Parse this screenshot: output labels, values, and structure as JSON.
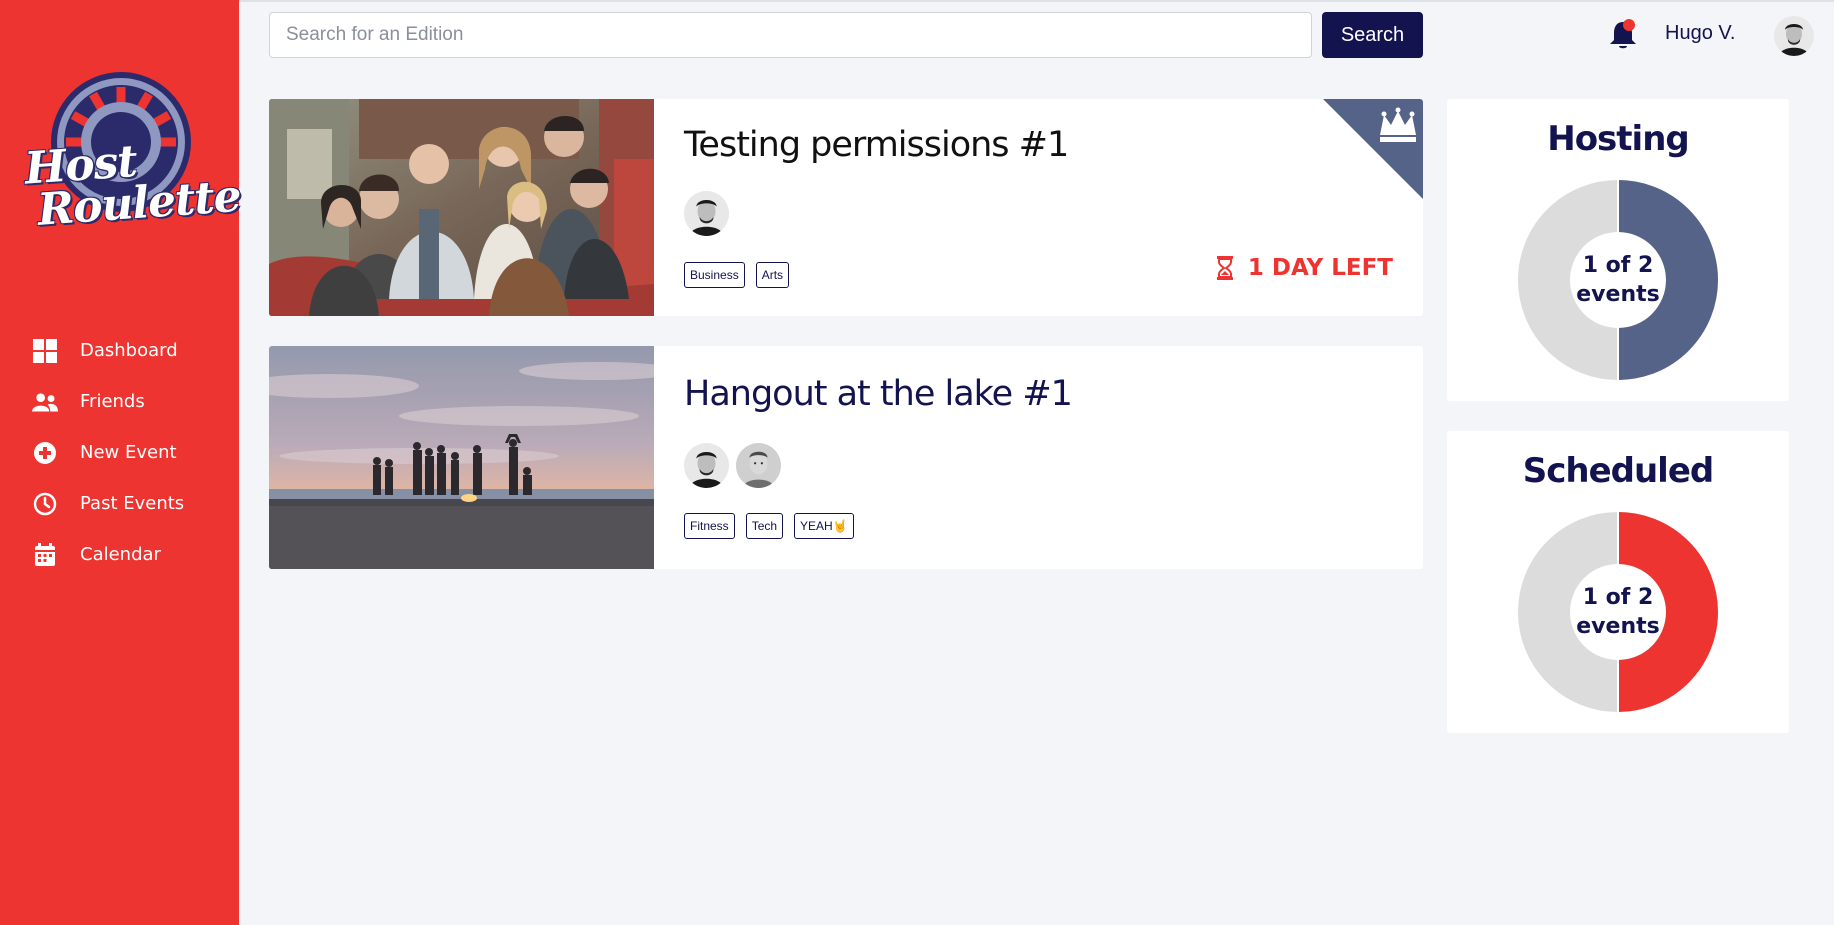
{
  "sidebar": {
    "logo": {
      "line1": "Host",
      "line2": "Roulette"
    },
    "items": [
      {
        "label": "Dashboard",
        "icon": "dashboard-icon"
      },
      {
        "label": "Friends",
        "icon": "friends-icon"
      },
      {
        "label": "New Event",
        "icon": "plus-circle-icon"
      },
      {
        "label": "Past Events",
        "icon": "clock-icon"
      },
      {
        "label": "Calendar",
        "icon": "calendar-icon"
      }
    ]
  },
  "header": {
    "search_placeholder": "Search for an Edition",
    "search_value": "",
    "search_button": "Search",
    "user_name": "Hugo V."
  },
  "events": [
    {
      "title": "Testing permissions #1",
      "tags": [
        "Business",
        "Arts"
      ],
      "badge": "1 DAY LEFT",
      "host_icon": "crown-icon"
    },
    {
      "title": "Hangout at the lake #1",
      "tags": [
        "Fitness",
        "Tech",
        "YEAH🤘"
      ]
    }
  ],
  "stats": {
    "hosting": {
      "title": "Hosting",
      "count": 1,
      "total": 2,
      "line1": "1 of 2",
      "line2": "events",
      "color": "#556388"
    },
    "scheduled": {
      "title": "Scheduled",
      "count": 1,
      "total": 2,
      "line1": "1 of 2",
      "line2": "events",
      "color": "#ee3430"
    }
  },
  "colors": {
    "sidebar": "#ee3430",
    "primary": "#13134f",
    "accent": "#556388",
    "background": "#f4f5f9",
    "donut_track": "#dcdcdc"
  }
}
